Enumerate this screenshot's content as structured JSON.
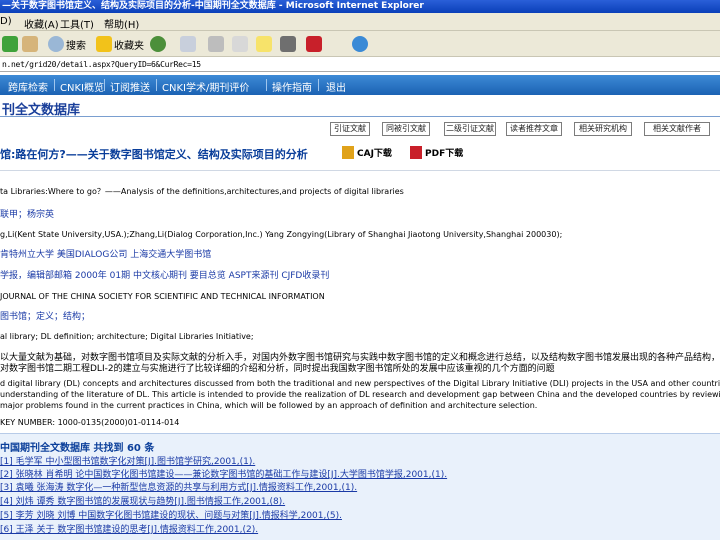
{
  "window": {
    "title": "—关于数字图书馆定义、结构及实际项目的分析-中国期刊全文数据库 - Microsoft Internet Explorer"
  },
  "menu": [
    "D)",
    "收藏(A)",
    "工具(T)",
    "帮助(H)"
  ],
  "toolbar": {
    "search": "搜索",
    "favorites": "收藏夹"
  },
  "address": "n.net/grid20/detail.aspx?QueryID=6&CurRec=15",
  "nav": [
    "跨库检索",
    "CNKI概览",
    "订阅推送",
    "CNKI学术/期刊评价",
    "操作指南",
    "退出"
  ],
  "db_title": "刊全文数据库",
  "buttons": [
    "引证文献",
    "同被引文献",
    "二级引证文献",
    "读者推荐文章",
    "相关研究机构",
    "相关文献作者"
  ],
  "article": {
    "title": "馆:路在何方?——关于数字图书馆定义、结构及实际项目的分析",
    "caj": "CAJ下载",
    "pdf": "PDF下载",
    "en_title": "ta Libraries:Where to go？——Analysis of the definitions,architectures,and projects of digital libraries",
    "authors": "联甲；杨宗英",
    "en_authors": "g,Li(Kent State University,USA.);Zhang,Li(Dialog Corporation,Inc.) Yang Zongying(Library of Shanghai Jiaotong University,Shanghai 200030);",
    "affiliation": "肯特州立大学 美国DIALOG公司 上海交通大学图书馆",
    "journal": "学报，编辑部邮箱  2000年 01期  中文核心期刊 要目总览 ASPT来源刊 CJFD收录刊",
    "en_journal": "JOURNAL OF THE CHINA SOCIETY FOR SCIENTIFIC AND TECHNICAL INFORMATION",
    "keywords": "图书馆；定义；结构；",
    "en_keywords": "al library; DL definition; architecture; Digital Libraries Initiative;",
    "abstract": "以大量文献为基础，对数字图书馆项目及实际文献的分析入手，对国内外数字图书馆研究与实践中数字图书馆的定义和概念进行总结，以及结构数字图书馆发展出现的各种产品结构，并以19",
    "abstract2": "对数字图书馆二期工程DLI-2的建立与实施进行了比较详细的介绍和分析，同时提出我国数字图书馆所处的发展中应该重视的几个方面的问题",
    "en_abstract": "d digital library (DL) concepts and architectures discussed from both the traditional and new perspectives of the Digital Library Initiative (DLI) projects in the USA and other countries to develop DLs, is certainly",
    "en_abstract2": "understanding of the literature of DL. This article is intended to provide the realization of DL research and development gap between China and the developed countries by reviewing the development process of DL projects",
    "en_abstract3": "major problems found in the current practices in China, which will be followed by an approach of definition and architecture selection.",
    "classification": "KEY NUMBER: 1000-0135(2000)01-0114-014"
  },
  "refs": {
    "heading": "中国期刊全文数据库 共找到 60 条",
    "items": [
      "[1] 毛学军 中小型图书馆数字化对策[J].图书馆学研究,2001,(1).",
      "[2] 张晓林 肖希明 论中国数字化图书馆建设——兼论数字图书馆的基础工作与建设[J].大学图书馆学报,2001,(1).",
      "[3] 袁曦 张海涛 数字化—一种新型信息资源的共享与利用方式[J].情报资料工作,2001,(1).",
      "[4] 刘炜 谭秀 数字图书馆的发展现状与趋势[J].图书情报工作,2001,(8).",
      "[5] 李芳 刘晓 刘博 中国数字化图书馆建设的现状、问题与对策[J].情报科学,2001,(5).",
      "[6] 王泽 关于 数字图书馆建设的思考[J].情报资料工作,2001,(2)."
    ]
  },
  "colors": {
    "nav_band": "#1b62b3",
    "title_blue": "#0a3e9a",
    "ref_background": "#e9f1fb"
  }
}
